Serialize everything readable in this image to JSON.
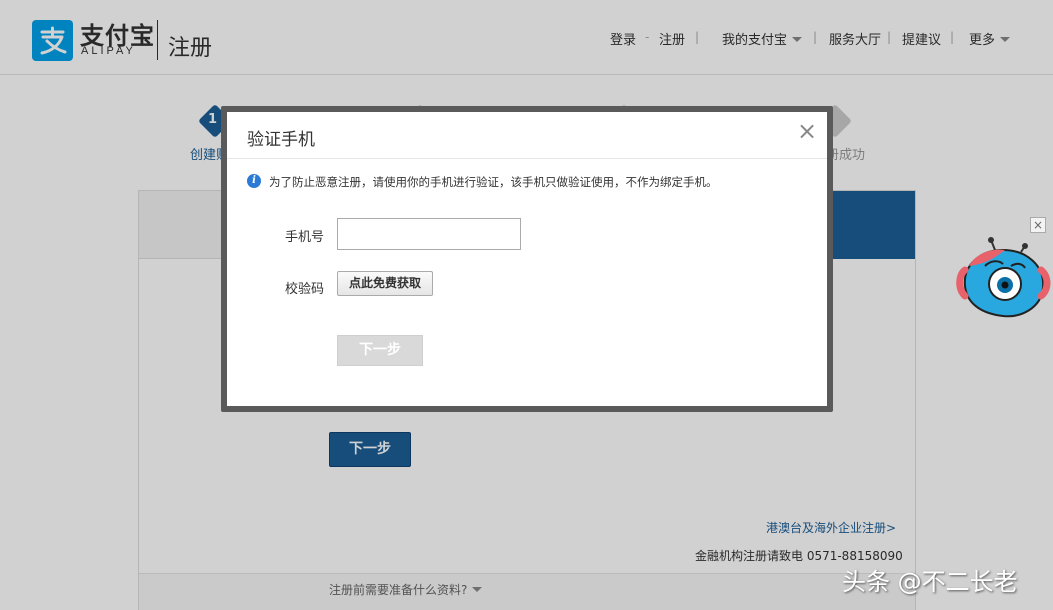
{
  "header": {
    "logo_text": "支付宝",
    "logo_sub": "ALIPAY",
    "page_title": "注册",
    "nav": {
      "login": "登录",
      "dash": "-",
      "register": "注册",
      "sep": "|",
      "my_alipay": "我的支付宝",
      "service_hall": "服务大厅",
      "suggest": "提建议",
      "more": "更多"
    }
  },
  "steps": {
    "step1_num": "1",
    "step1_label": "创建账",
    "step4_label": "册成功"
  },
  "background": {
    "next_button": "下一步",
    "overseas_link": "港澳台及海外企业注册>",
    "finance_phone": "金融机构注册请致电 0571-88158090",
    "prepare_link": "注册前需要准备什么资料?"
  },
  "dialog": {
    "title": "验证手机",
    "close": "×",
    "info_icon": "i",
    "info_text": "为了防止恶意注册，请使用你的手机进行验证，该手机只做验证使用，不作为绑定手机。",
    "phone_label": "手机号",
    "phone_value": "",
    "code_label": "校验码",
    "get_code_button": "点此免费获取",
    "next_button": "下一步"
  },
  "mascot": {
    "close": "×"
  },
  "watermark": "头条 @不二长老",
  "colors": {
    "brand_blue": "#00a0e9",
    "primary_button": "#1b5e97",
    "link": "#1b5e97",
    "disabled_button": "#d9d9d9"
  }
}
